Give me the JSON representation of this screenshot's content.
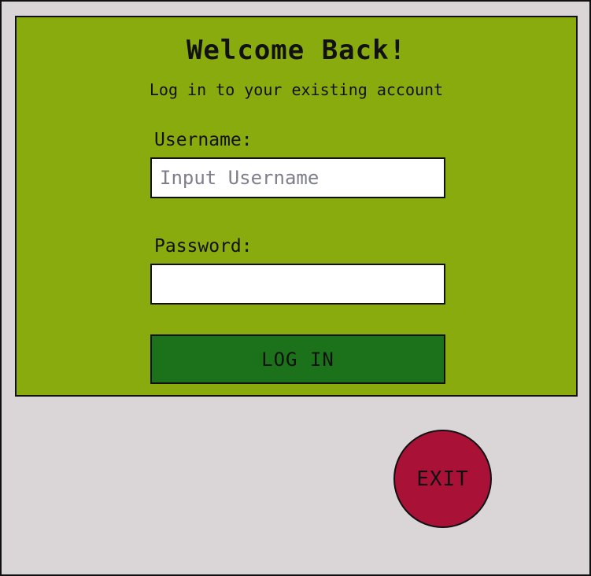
{
  "login": {
    "title": "Welcome Back!",
    "subtitle": "Log in to your existing account",
    "username_label": "Username:",
    "username_placeholder": "Input Username",
    "username_value": "",
    "password_label": "Password:",
    "password_value": "",
    "login_button_label": "LOG IN"
  },
  "exit_button_label": "EXIT",
  "colors": {
    "background": "#dad6d8",
    "panel": "#8aab0e",
    "login_button": "#1c721a",
    "exit_button": "#a91236"
  }
}
